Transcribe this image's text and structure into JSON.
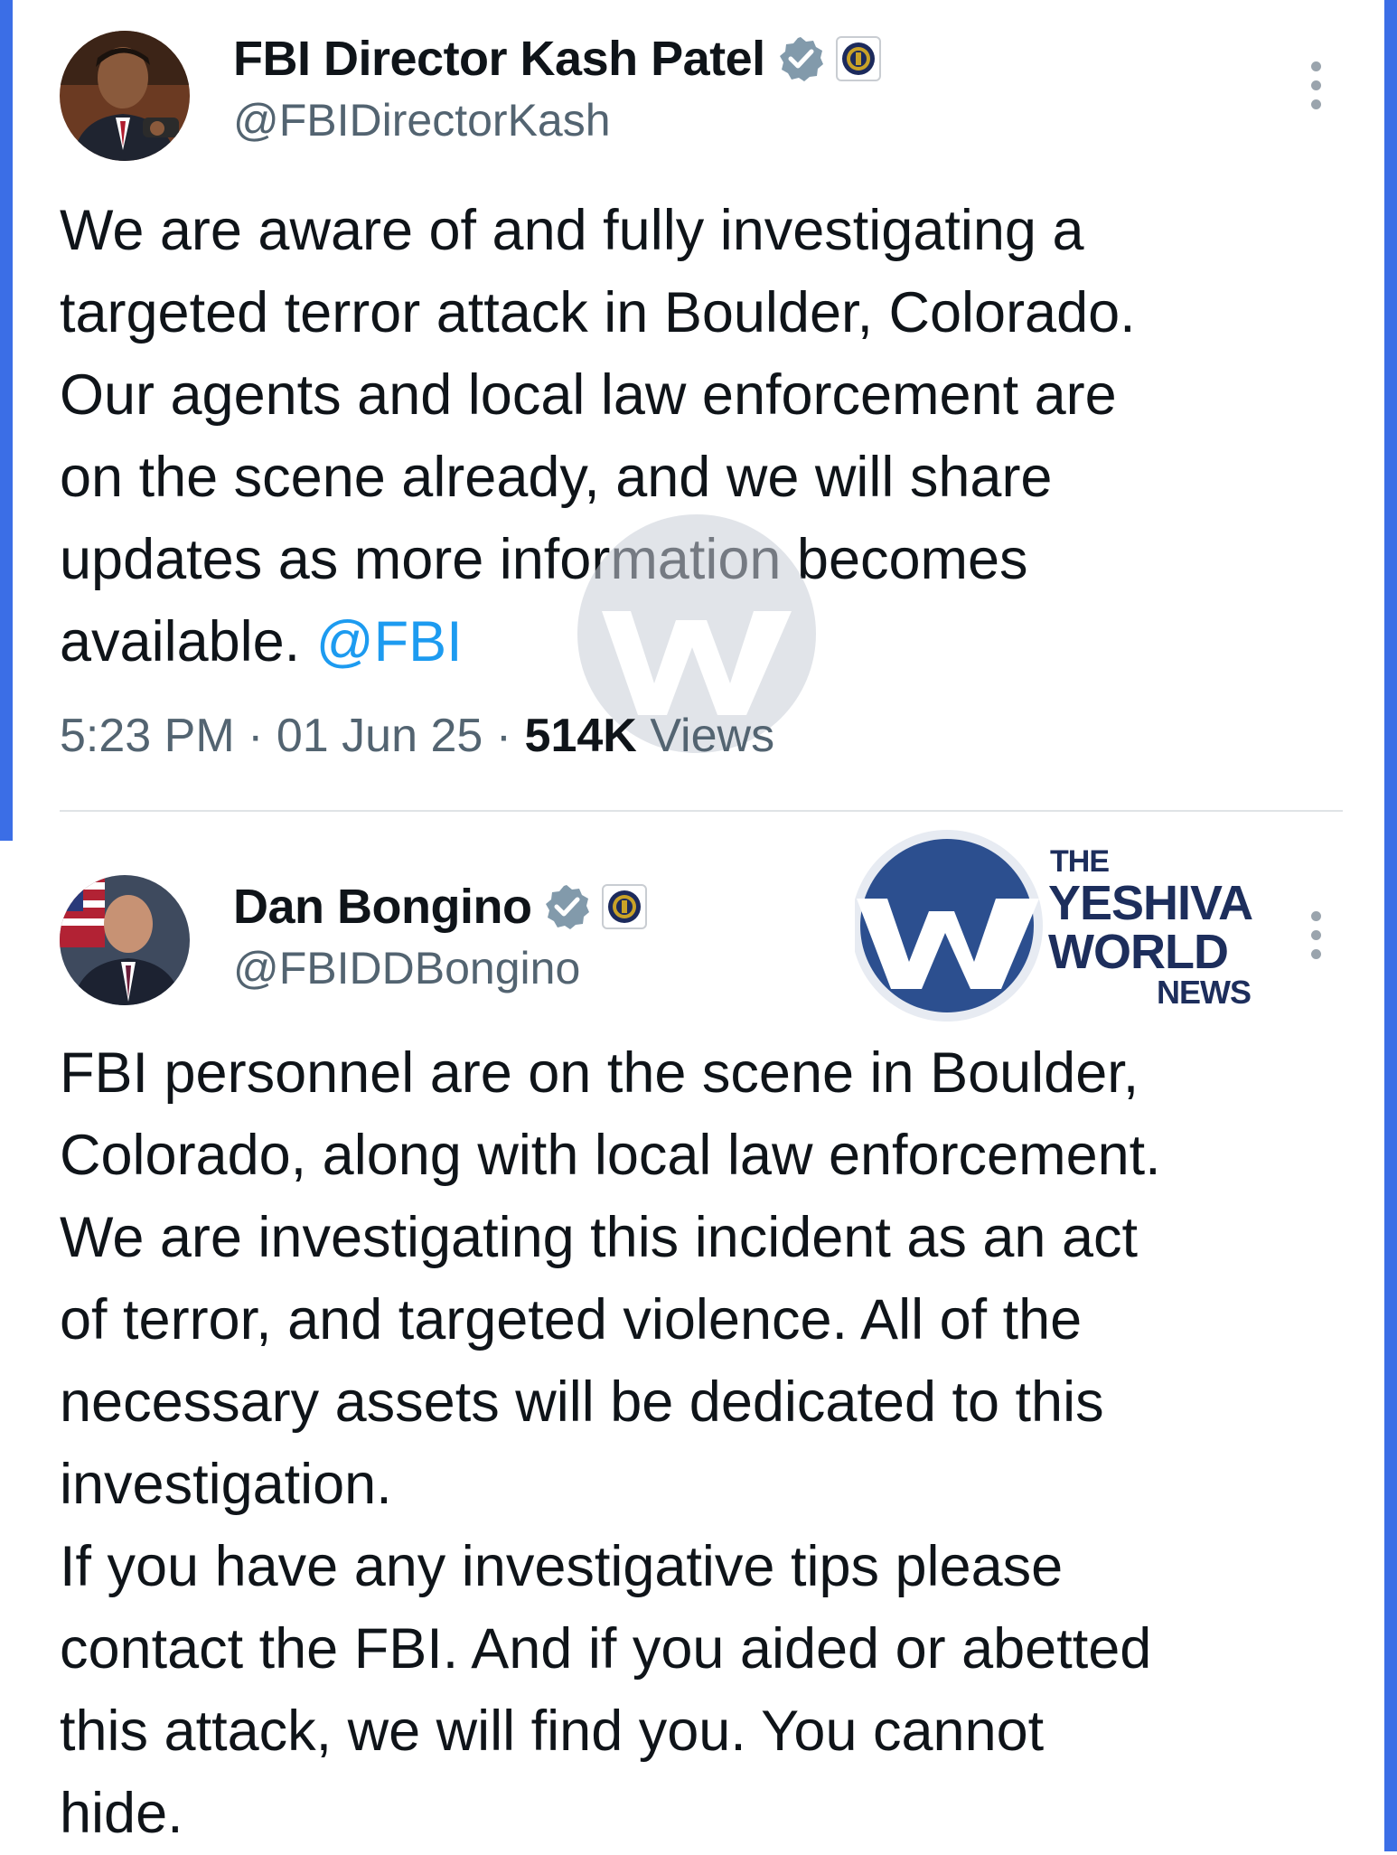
{
  "tweets": [
    {
      "display_name": "FBI Director Kash Patel",
      "handle": "@FBIDirectorKash",
      "text": "We are aware of and fully investigating a\ntargeted terror attack in Boulder, Colorado.\nOur agents and local law enforcement are\non the scene already, and we will share\nupdates as more information becomes\navailable.",
      "mention": "@FBI",
      "time": "5:23 PM",
      "date": "01 Jun 25",
      "views_count": "514K",
      "views_label": "Views",
      "separator": "·"
    },
    {
      "display_name": "Dan Bongino",
      "handle": "@FBIDDBongino",
      "text": "FBI personnel are on the scene in Boulder,\nColorado, along with local law enforcement.\nWe are investigating this incident as an act\nof terror, and targeted violence. All of the\nnecessary assets will be dedicated to this\ninvestigation.\nIf you have any investigative tips please\ncontact the FBI. And if you aided or abetted\nthis attack, we will find you. You cannot\nhide."
    }
  ],
  "watermark": {
    "line1": "THE",
    "line2": "YESHIVA",
    "line3": "WORLD",
    "line4": "NEWS"
  },
  "icons": {
    "verified": "verified-badge-icon",
    "affiliate": "fbi-seal-icon",
    "more": "more-options-icon"
  },
  "colors": {
    "border": "#3b6ee6",
    "mention": "#1d9bf0",
    "verified": "#829aab",
    "text": "#0f1419",
    "secondary": "#536471"
  }
}
